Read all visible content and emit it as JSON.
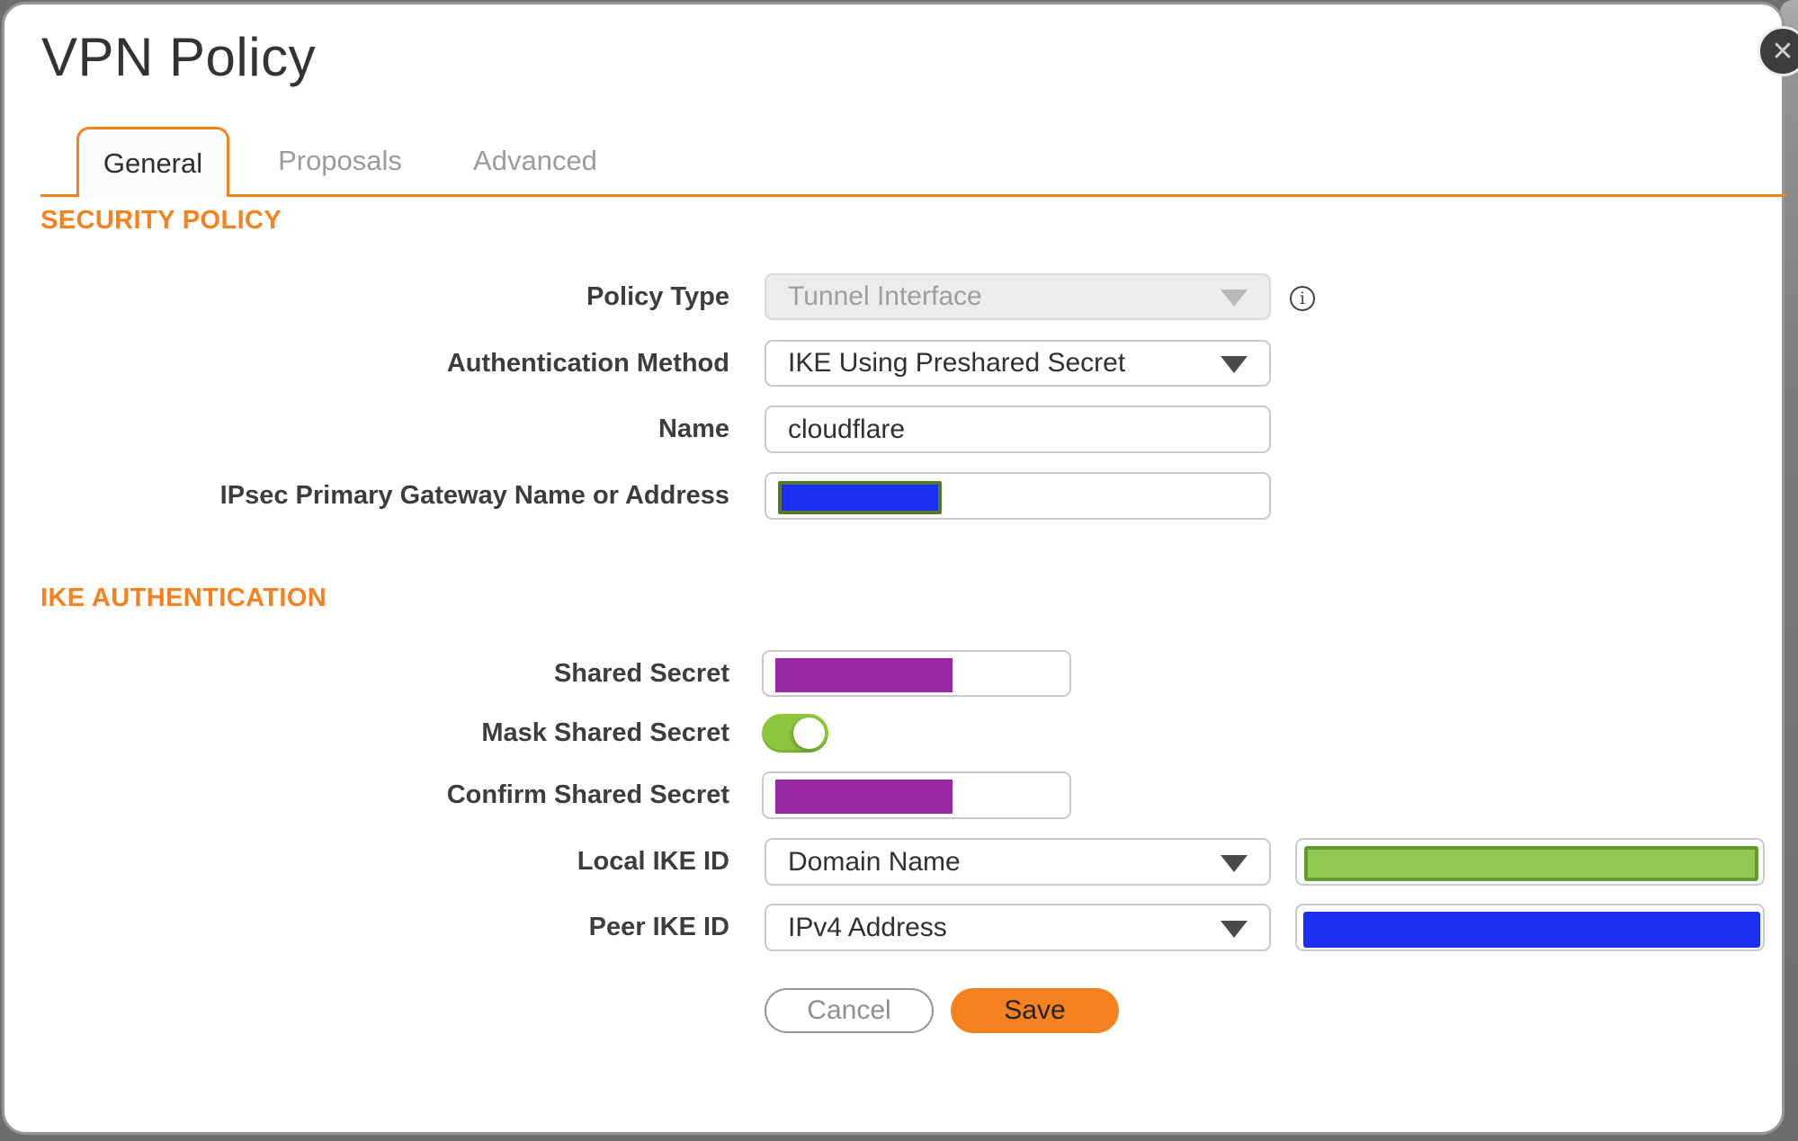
{
  "window": {
    "title": "VPN Policy",
    "close_icon": "✕"
  },
  "tabs": [
    {
      "label": "General",
      "active": true
    },
    {
      "label": "Proposals",
      "active": false
    },
    {
      "label": "Advanced",
      "active": false
    }
  ],
  "sections": {
    "security_policy": "SECURITY POLICY",
    "ike_authentication": "IKE AUTHENTICATION"
  },
  "fields": {
    "policy_type": {
      "label": "Policy Type",
      "value": "Tunnel Interface",
      "disabled": true,
      "info_icon": "i"
    },
    "authentication_method": {
      "label": "Authentication Method",
      "value": "IKE Using Preshared Secret"
    },
    "name": {
      "label": "Name",
      "value": "cloudflare"
    },
    "ipsec_primary_gateway": {
      "label": "IPsec Primary Gateway Name or Address",
      "value": "",
      "value_redacted": true
    },
    "shared_secret": {
      "label": "Shared Secret",
      "value": "",
      "value_redacted": true
    },
    "mask_shared_secret": {
      "label": "Mask Shared Secret",
      "state": "on"
    },
    "confirm_shared_secret": {
      "label": "Confirm Shared Secret",
      "value": "",
      "value_redacted": true
    },
    "local_ike_id": {
      "label": "Local IKE ID",
      "value": "Domain Name",
      "extra_value": "",
      "extra_value_redacted": true
    },
    "peer_ike_id": {
      "label": "Peer IKE ID",
      "value": "IPv4 Address",
      "extra_value": "",
      "extra_value_redacted": true
    }
  },
  "buttons": {
    "cancel": "Cancel",
    "save": "Save"
  },
  "colors": {
    "accent_orange": "#F6821F",
    "toggle_green": "#8CC63C",
    "redaction_purple": "#9A28A2",
    "redaction_blue": "#1B2FF2",
    "redaction_green_fill": "#8FC953",
    "redaction_green_border": "#639B31",
    "redaction_olive_border": "#527A28",
    "close_button_bg": "#3d3d3d"
  }
}
